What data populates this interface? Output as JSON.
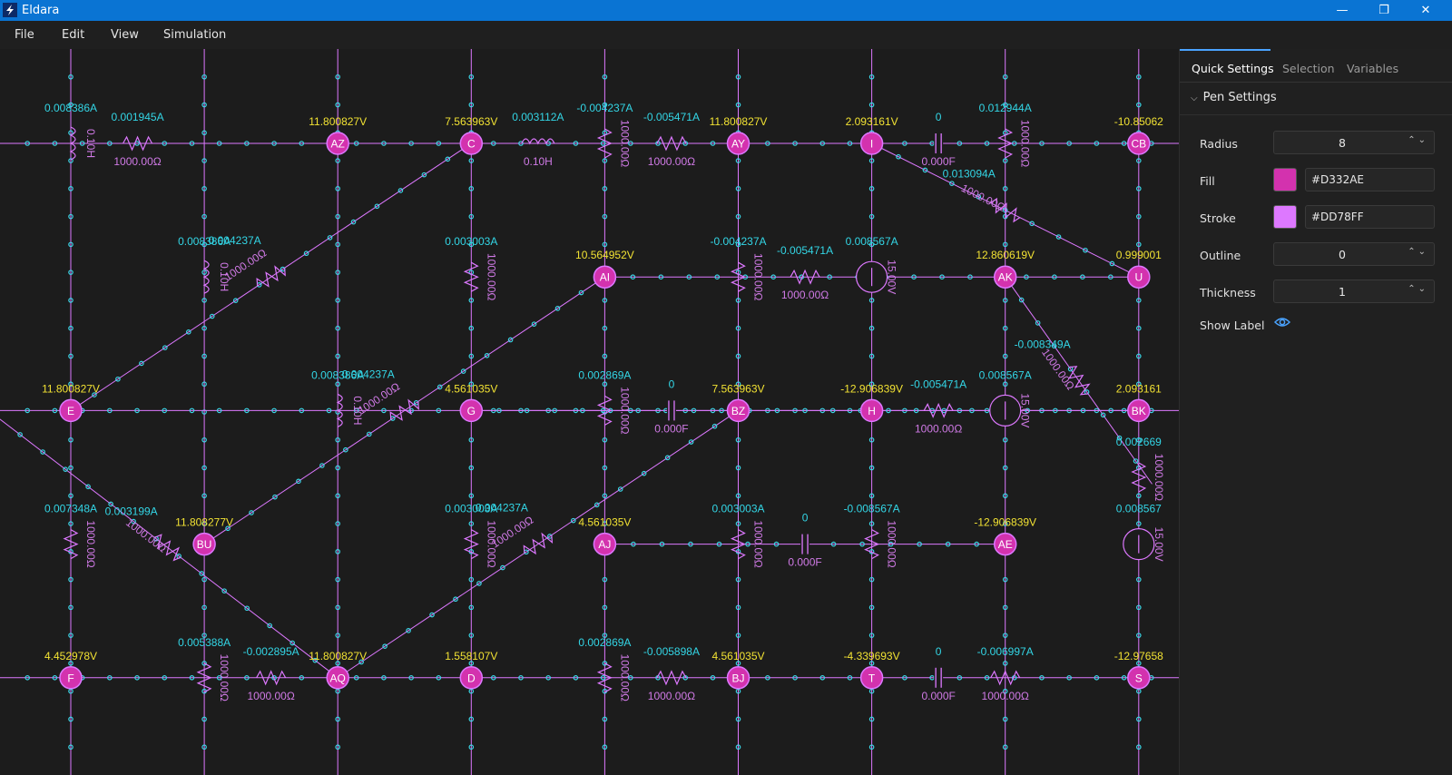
{
  "app": {
    "title": "Eldara"
  },
  "window_controls": {
    "minimize": "—",
    "maximize": "❐",
    "close": "✕"
  },
  "menu": [
    "File",
    "Edit",
    "View",
    "Simulation"
  ],
  "colors": {
    "node_fill": "#D332AE",
    "node_stroke": "#DD78FF",
    "wire": "#DD78FF",
    "dot": "#3ad6e6",
    "current_label": "#33d6e6",
    "voltage_label": "#f2e233",
    "component_label": "#d07ae6",
    "accent": "#0a74d3"
  },
  "panel": {
    "tabs": [
      "Quick Settings",
      "Selection",
      "Variables"
    ],
    "active_tab": "Quick Settings",
    "section": "Pen Settings",
    "radius": {
      "label": "Radius",
      "value": "8"
    },
    "fill": {
      "label": "Fill",
      "value": "#D332AE"
    },
    "stroke": {
      "label": "Stroke",
      "value": "#DD78FF"
    },
    "outline": {
      "label": "Outline",
      "value": "0"
    },
    "thickness": {
      "label": "Thickness",
      "value": "1"
    },
    "show_label": {
      "label": "Show Label",
      "icon": "eye-icon"
    }
  },
  "circuit": {
    "nodes": [
      {
        "id": "AZ",
        "col": 2,
        "row": 0,
        "volt": "11.800827V"
      },
      {
        "id": "C",
        "col": 3,
        "row": 0,
        "volt": "7.563963V"
      },
      {
        "id": "AY",
        "col": 5,
        "row": 0,
        "volt": "11.800827V"
      },
      {
        "id": "I",
        "col": 6,
        "row": 0,
        "volt": "2.093161V"
      },
      {
        "id": "CB",
        "col": 8,
        "row": 0,
        "volt": "-10.85062"
      },
      {
        "id": "AI",
        "col": 4,
        "row": 1,
        "volt": "10.564952V"
      },
      {
        "id": "AK",
        "col": 7,
        "row": 1,
        "volt": "12.860619V"
      },
      {
        "id": "U",
        "col": 8,
        "row": 1,
        "volt": "0.999001"
      },
      {
        "id": "E",
        "col": 0,
        "row": 2,
        "volt": "11.800827V"
      },
      {
        "id": "G",
        "col": 3,
        "row": 2,
        "volt": "4.561035V"
      },
      {
        "id": "BZ",
        "col": 5,
        "row": 2,
        "volt": "7.563963V"
      },
      {
        "id": "H",
        "col": 6,
        "row": 2,
        "volt": "-12.906839V"
      },
      {
        "id": "BK",
        "col": 8,
        "row": 2,
        "volt": "2.093161"
      },
      {
        "id": "BU",
        "col": 1,
        "row": 3,
        "volt": "11.808277V"
      },
      {
        "id": "AJ",
        "col": 4,
        "row": 3,
        "volt": "4.561035V"
      },
      {
        "id": "AE",
        "col": 7,
        "row": 3,
        "volt": "-12.906839V"
      },
      {
        "id": "F",
        "col": 0,
        "row": 4,
        "volt": "4.452978V"
      },
      {
        "id": "AQ",
        "col": 2,
        "row": 4,
        "volt": "11.800827V"
      },
      {
        "id": "D",
        "col": 3,
        "row": 4,
        "volt": "1.558107V"
      },
      {
        "id": "BJ",
        "col": 5,
        "row": 4,
        "volt": "4.561035V"
      },
      {
        "id": "T",
        "col": 6,
        "row": 4,
        "volt": "-4.339693V"
      },
      {
        "id": "S",
        "col": 8,
        "row": 4,
        "volt": "-12.97658"
      }
    ],
    "components": [
      {
        "kind": "inductor",
        "col": 0,
        "row": 0,
        "dir": "v",
        "value": "0.10H",
        "current": "0.008386A"
      },
      {
        "kind": "resistor",
        "col": 0.5,
        "row": 0,
        "dir": "h",
        "value": "1000.00Ω",
        "current": "0.001945A"
      },
      {
        "kind": "inductor",
        "col": 3.5,
        "row": 0,
        "dir": "h",
        "value": "0.10H",
        "current": "0.003112A"
      },
      {
        "kind": "resistor",
        "col": 4,
        "row": 0,
        "dir": "v",
        "value": "1000.00Ω",
        "current": "-0.004237A"
      },
      {
        "kind": "resistor",
        "col": 4.5,
        "row": 0,
        "dir": "h",
        "value": "1000.00Ω",
        "current": "-0.005471A"
      },
      {
        "kind": "capacitor",
        "col": 6.5,
        "row": 0,
        "dir": "h",
        "value": "0.000F",
        "current": "0"
      },
      {
        "kind": "resistor",
        "col": 7,
        "row": 0,
        "dir": "v",
        "value": "1000.00Ω",
        "current": "0.012944A"
      },
      {
        "kind": "inductor",
        "col": 1,
        "row": 1,
        "dir": "v",
        "value": "0.10H",
        "current": "0.008386A"
      },
      {
        "kind": "resistor",
        "col": 3,
        "row": 1,
        "dir": "v",
        "value": "1000.00Ω",
        "current": "0.003003A"
      },
      {
        "kind": "resistor",
        "col": 5,
        "row": 1,
        "dir": "v",
        "value": "1000.00Ω",
        "current": "-0.004237A"
      },
      {
        "kind": "resistor",
        "col": 5.5,
        "row": 1,
        "dir": "h",
        "value": "1000.00Ω",
        "current": "-0.005471A"
      },
      {
        "kind": "source",
        "col": 6,
        "row": 1,
        "dir": "v",
        "value": "15.00V",
        "current": "0.008567A"
      },
      {
        "kind": "inductor",
        "col": 2,
        "row": 2,
        "dir": "v",
        "value": "0.10H",
        "current": "0.008386A"
      },
      {
        "kind": "resistor",
        "col": 4,
        "row": 2,
        "dir": "v",
        "value": "1000.00Ω",
        "current": "0.002869A"
      },
      {
        "kind": "capacitor",
        "col": 4.5,
        "row": 2,
        "dir": "h",
        "value": "0.000F",
        "current": "0"
      },
      {
        "kind": "resistor",
        "col": 6.5,
        "row": 2,
        "dir": "h",
        "value": "1000.00Ω",
        "current": "-0.005471A"
      },
      {
        "kind": "source",
        "col": 7,
        "row": 2,
        "dir": "v",
        "value": "15.00V",
        "current": "0.008567A"
      },
      {
        "kind": "resistor",
        "col": 8,
        "row": 2.5,
        "dir": "v",
        "value": "1000.00Ω",
        "current": "0.002669"
      },
      {
        "kind": "resistor",
        "col": 0,
        "row": 3,
        "dir": "v",
        "value": "1000.00Ω",
        "current": "0.007348A"
      },
      {
        "kind": "resistor",
        "col": 3,
        "row": 3,
        "dir": "v",
        "value": "1000.00Ω",
        "current": "0.003003A"
      },
      {
        "kind": "resistor",
        "col": 5,
        "row": 3,
        "dir": "v",
        "value": "1000.00Ω",
        "current": "0.003003A"
      },
      {
        "kind": "capacitor",
        "col": 5.5,
        "row": 3,
        "dir": "h",
        "value": "0.000F",
        "current": "0"
      },
      {
        "kind": "resistor",
        "col": 6,
        "row": 3,
        "dir": "v",
        "value": "1000.00Ω",
        "current": "-0.008567A"
      },
      {
        "kind": "source",
        "col": 8,
        "row": 3,
        "dir": "v",
        "value": "15.00V",
        "current": "0.008567"
      },
      {
        "kind": "resistor",
        "col": 1,
        "row": 4,
        "dir": "v",
        "value": "1000.00Ω",
        "current": "0.005388A"
      },
      {
        "kind": "resistor",
        "col": 1.5,
        "row": 4,
        "dir": "h",
        "value": "1000.00Ω",
        "current": "-0.002895A"
      },
      {
        "kind": "resistor",
        "col": 4,
        "row": 4,
        "dir": "v",
        "value": "1000.00Ω",
        "current": "0.002869A"
      },
      {
        "kind": "resistor",
        "col": 4.5,
        "row": 4,
        "dir": "h",
        "value": "1000.00Ω",
        "current": "-0.005898A"
      },
      {
        "kind": "capacitor",
        "col": 6.5,
        "row": 4,
        "dir": "h",
        "value": "0.000F",
        "current": "0"
      },
      {
        "kind": "resistor",
        "col": 7,
        "row": 4,
        "dir": "h",
        "value": "1000.00Ω",
        "current": "-0.006997A"
      }
    ],
    "diagonals": [
      {
        "from": "E",
        "to": "C",
        "value": "1000.00Ω",
        "current": "0.004237A"
      },
      {
        "from": "BU",
        "to": "AI",
        "value": "1000.00Ω",
        "current": "0.004237A"
      },
      {
        "from": "AQ",
        "to": "BZ",
        "value": "1000.00Ω",
        "current": "0.004237A"
      },
      {
        "from": "I",
        "to": "U",
        "value": "1000.00Ω",
        "current": "0.013094A"
      },
      {
        "from": "AK",
        "to": "BKx",
        "value": "1000.00Ω",
        "current": "-0.008349A"
      },
      {
        "from": "Ex",
        "to": "AQ",
        "value": "1000.00Ω",
        "current": "0.003199A"
      }
    ]
  }
}
